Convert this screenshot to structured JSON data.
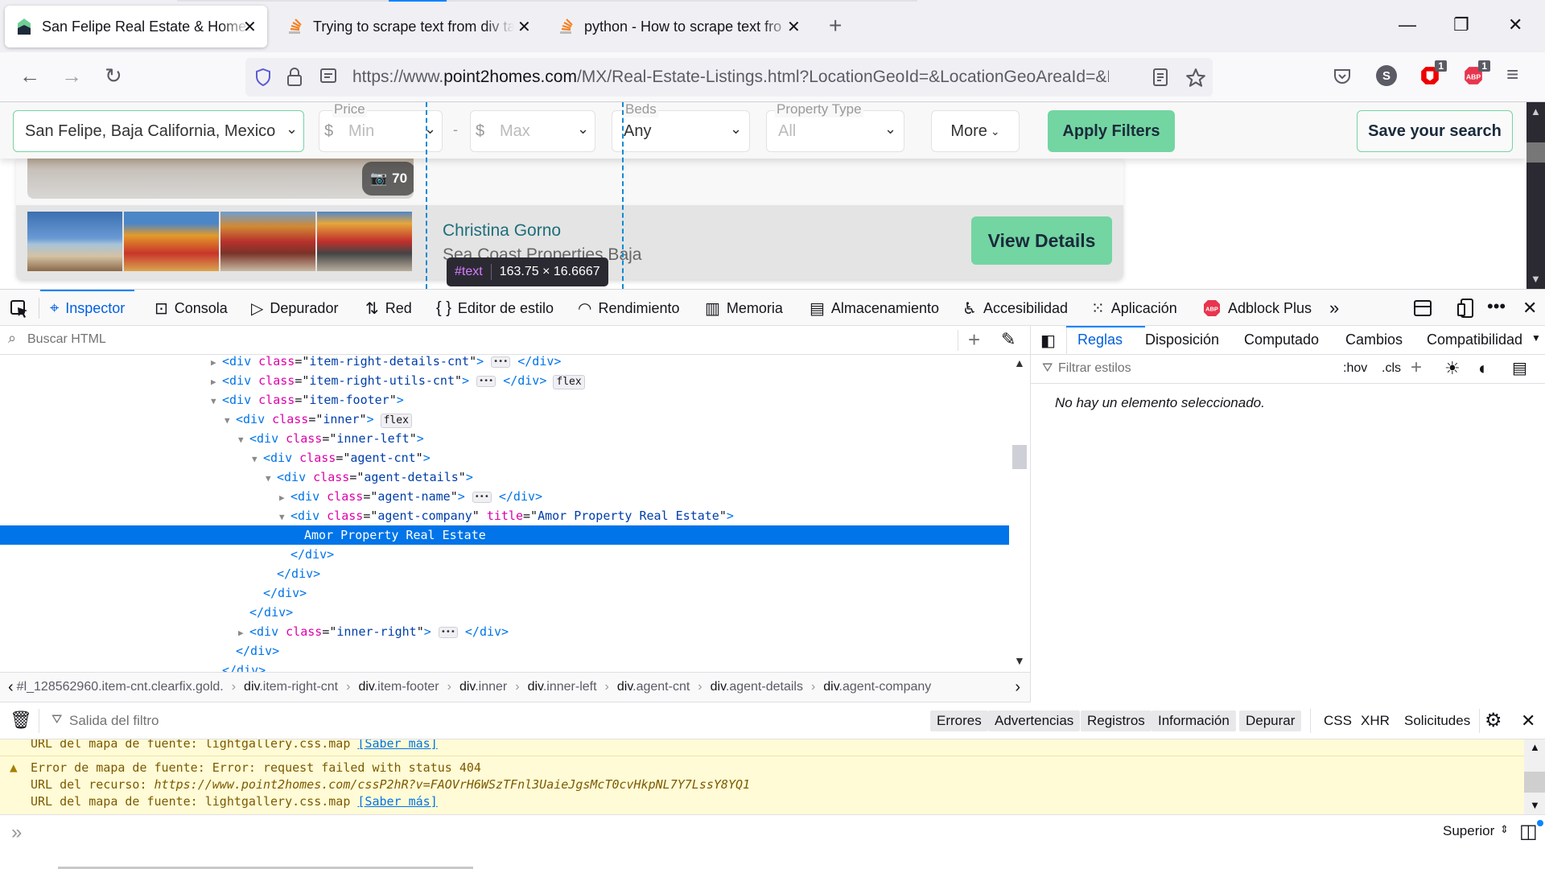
{
  "browser": {
    "tabs": [
      {
        "title": "San Felipe Real Estate & Homes",
        "favicon": "point2homes-house-icon",
        "active": true
      },
      {
        "title": "Trying to scrape text from div ta",
        "favicon": "stackoverflow-icon",
        "active": false
      },
      {
        "title": "python - How to scrape text fro",
        "favicon": "stackoverflow-icon",
        "active": false
      }
    ],
    "close_glyph": "✕",
    "new_tab_glyph": "+",
    "window_controls": {
      "minimize": "—",
      "restore": "❐",
      "close": "✕"
    },
    "url": {
      "prefix": "https://www.",
      "domain": "point2homes.com",
      "path": "/MX/Real-Estate-Listings.html?LocationGeoId=&LocationGeoAreaId=&LocationS"
    },
    "extensions": [
      {
        "name": "pocket",
        "glyph": "⛉"
      },
      {
        "name": "s-extension",
        "glyph": "S"
      },
      {
        "name": "ublock",
        "badge": "1"
      },
      {
        "name": "adblock-plus",
        "label": "ABP",
        "badge": "1"
      }
    ]
  },
  "page": {
    "filters": {
      "location": "San Felipe, Baja California, Mexico",
      "price_label": "Price",
      "currency": "$",
      "min_placeholder": "Min",
      "max_placeholder": "Max",
      "range_sep": "-",
      "beds_label": "Beds",
      "beds_value": "Any",
      "type_label": "Property Type",
      "type_value": "All",
      "more_label": "More",
      "apply_label": "Apply Filters",
      "save_label": "Save your search"
    },
    "listing1": {
      "photo_count": "70"
    },
    "listing2": {
      "agent_name": "Christina Gorno",
      "agent_company": "Sea Coast Properties Baja",
      "view_details": "View Details"
    },
    "highlight_tooltip": {
      "node": "#text",
      "size": "163.75 × 16.6667"
    }
  },
  "devtools": {
    "tabs": [
      {
        "label": "Inspector",
        "icon": "inspector-icon",
        "selected": true
      },
      {
        "label": "Consola",
        "icon": "console-icon"
      },
      {
        "label": "Depurador",
        "icon": "debugger-icon"
      },
      {
        "label": "Red",
        "icon": "network-icon"
      },
      {
        "label": "Editor de estilo",
        "icon": "style-editor-icon"
      },
      {
        "label": "Rendimiento",
        "icon": "performance-icon"
      },
      {
        "label": "Memoria",
        "icon": "memory-icon"
      },
      {
        "label": "Almacenamiento",
        "icon": "storage-icon"
      },
      {
        "label": "Accesibilidad",
        "icon": "accessibility-icon"
      },
      {
        "label": "Aplicación",
        "icon": "application-icon"
      },
      {
        "label": "Adblock Plus",
        "icon": "adblock-plus-icon"
      }
    ],
    "search_placeholder": "Buscar HTML",
    "markup": [
      {
        "indent": 0,
        "twisty": "closed",
        "open": "<div",
        "attr": "class",
        "val": "item-right-details-cnt",
        "tail": "ellipsis-close"
      },
      {
        "indent": 0,
        "twisty": "closed",
        "open": "<div",
        "attr": "class",
        "val": "item-right-utils-cnt",
        "tail": "ellipsis-close",
        "badge": "flex"
      },
      {
        "indent": 0,
        "twisty": "open",
        "open": "<div",
        "attr": "class",
        "val": "item-footer"
      },
      {
        "indent": 1,
        "twisty": "open",
        "open": "<div",
        "attr": "class",
        "val": "inner",
        "badge": "flex"
      },
      {
        "indent": 2,
        "twisty": "open",
        "open": "<div",
        "attr": "class",
        "val": "inner-left"
      },
      {
        "indent": 3,
        "twisty": "open",
        "open": "<div",
        "attr": "class",
        "val": "agent-cnt"
      },
      {
        "indent": 4,
        "twisty": "open",
        "open": "<div",
        "attr": "class",
        "val": "agent-details"
      },
      {
        "indent": 5,
        "twisty": "closed",
        "open": "<div",
        "attr": "class",
        "val": "agent-name",
        "tail": "ellipsis-close"
      },
      {
        "indent": 5,
        "twisty": "open",
        "open": "<div",
        "attr": "class",
        "val": "agent-company",
        "attr2": "title",
        "val2": "Amor Property Real Estate"
      },
      {
        "indent": 6,
        "text": "Amor Property Real Estate",
        "selected": true
      },
      {
        "indent": 5,
        "close": "</div>"
      },
      {
        "indent": 4,
        "close": "</div>"
      },
      {
        "indent": 3,
        "close": "</div>"
      },
      {
        "indent": 2,
        "close": "</div>"
      },
      {
        "indent": 2,
        "twisty": "closed",
        "open": "<div",
        "attr": "class",
        "val": "inner-right",
        "tail": "ellipsis-close"
      },
      {
        "indent": 1,
        "close": "</div>"
      },
      {
        "indent": 0,
        "close": "</div>"
      }
    ],
    "breadcrumbs": [
      {
        "tag": "",
        "rest": "#l_128562960.item-cnt.clearfix.gold."
      },
      {
        "tag": "div",
        "rest": ".item-right-cnt"
      },
      {
        "tag": "div",
        "rest": ".item-footer"
      },
      {
        "tag": "div",
        "rest": ".inner"
      },
      {
        "tag": "div",
        "rest": ".inner-left"
      },
      {
        "tag": "div",
        "rest": ".agent-cnt"
      },
      {
        "tag": "div",
        "rest": ".agent-details"
      },
      {
        "tag": "div",
        "rest": ".agent-company"
      }
    ],
    "rules": {
      "tabs": [
        "Reglas",
        "Disposición",
        "Computado",
        "Cambios",
        "Compatibilidad"
      ],
      "filter_placeholder": "Filtrar estilos",
      "hov": ":hov",
      "cls": ".cls",
      "empty_message": "No hay un elemento seleccionado."
    },
    "console": {
      "filter_placeholder": "Salida del filtro",
      "level_buttons": [
        "Errores",
        "Advertencias",
        "Registros",
        "Información",
        "Depurar"
      ],
      "type_links": [
        "CSS",
        "XHR",
        "Solicitudes"
      ],
      "messages": [
        {
          "prefix": "URL del mapa de fuente: lightgallery.css.map ",
          "link": "[Saber más]"
        },
        {
          "warning": true,
          "text": "Error de mapa de fuente: Error: request failed with status 404"
        },
        {
          "prefix": "URL del recurso: ",
          "italic": "https://www.point2homes.com/cssP2hR?v=FAOVrH6WSzTFnl3UaieJgsMcT0cvHkpNL7Y7LssY8YQ1"
        },
        {
          "prefix": "URL del mapa de fuente: lightgallery.css.map ",
          "link": "[Saber más]"
        }
      ],
      "context_selector": "Superior",
      "prompt_glyph": "»"
    }
  }
}
